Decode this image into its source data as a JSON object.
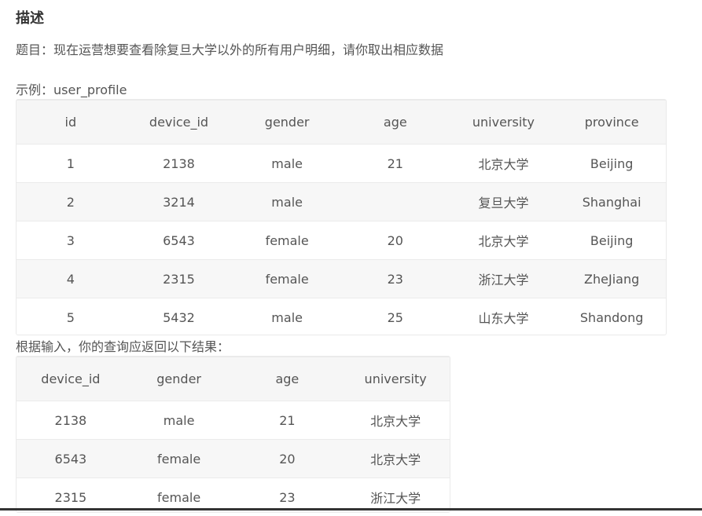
{
  "heading": "描述",
  "question": "题目：现在运营想要查看除复旦大学以外的所有用户明细，请你取出相应数据",
  "example_label": "示例：user_profile",
  "input_table": {
    "columns": [
      "id",
      "device_id",
      "gender",
      "age",
      "university",
      "province"
    ],
    "rows": [
      [
        "1",
        "2138",
        "male",
        "21",
        "北京大学",
        "Beijing"
      ],
      [
        "2",
        "3214",
        "male",
        "",
        "复旦大学",
        "Shanghai"
      ],
      [
        "3",
        "6543",
        "female",
        "20",
        "北京大学",
        "Beijing"
      ],
      [
        "4",
        "2315",
        "female",
        "23",
        "浙江大学",
        "ZheJiang"
      ],
      [
        "5",
        "5432",
        "male",
        "25",
        "山东大学",
        "Shandong"
      ]
    ]
  },
  "result_label": "根据输入，你的查询应返回以下结果：",
  "output_table": {
    "columns": [
      "device_id",
      "gender",
      "age",
      "university"
    ],
    "rows": [
      [
        "2138",
        "male",
        "21",
        "北京大学"
      ],
      [
        "6543",
        "female",
        "20",
        "北京大学"
      ],
      [
        "2315",
        "female",
        "23",
        "浙江大学"
      ]
    ]
  }
}
